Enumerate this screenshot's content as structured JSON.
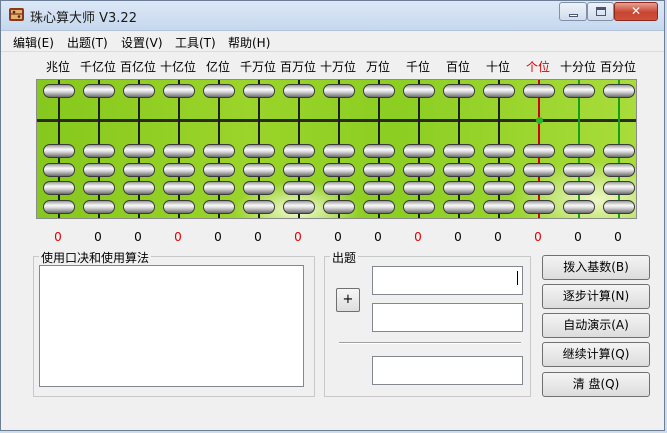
{
  "window": {
    "title": "珠心算大师 V3.22"
  },
  "menu": [
    "编辑(E)",
    "出题(T)",
    "设置(V)",
    "工具(T)",
    "帮助(H)"
  ],
  "columns": [
    {
      "label": "兆位",
      "digit": "0",
      "red": true
    },
    {
      "label": "千亿位",
      "digit": "0",
      "red": false
    },
    {
      "label": "百亿位",
      "digit": "0",
      "red": false
    },
    {
      "label": "十亿位",
      "digit": "0",
      "red": true
    },
    {
      "label": "亿位",
      "digit": "0",
      "red": false
    },
    {
      "label": "千万位",
      "digit": "0",
      "red": false
    },
    {
      "label": "百万位",
      "digit": "0",
      "red": true
    },
    {
      "label": "十万位",
      "digit": "0",
      "red": false
    },
    {
      "label": "万位",
      "digit": "0",
      "red": false
    },
    {
      "label": "千位",
      "digit": "0",
      "red": true
    },
    {
      "label": "百位",
      "digit": "0",
      "red": false
    },
    {
      "label": "十位",
      "digit": "0",
      "red": false
    },
    {
      "label": "个位",
      "digit": "0",
      "red": true
    },
    {
      "label": "十分位",
      "digit": "0",
      "red": false
    },
    {
      "label": "百分位",
      "digit": "0",
      "red": false
    }
  ],
  "label_highlight_index": 12,
  "colors": {
    "accent_red": "#e00000",
    "unit_rod": "#d00000",
    "decimal_rod": "#16a018",
    "frame_green": "#8cce22"
  },
  "panels": {
    "method_title": "使用口决和使用算法",
    "question_title": "出题",
    "plus_label": "+"
  },
  "buttons": [
    "拨入基数(B)",
    "逐步计算(N)",
    "自动演示(A)",
    "继续计算(Q)",
    "清   盘(Q)"
  ]
}
